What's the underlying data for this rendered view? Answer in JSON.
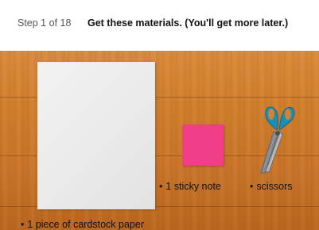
{
  "header": {
    "step": "Step 1 of 18",
    "title": "Get these materials. (You'll get more later.)"
  },
  "items": [
    {
      "bullet": "•",
      "label": "1 sticky note"
    },
    {
      "bullet": "•",
      "label": "scissors"
    },
    {
      "bullet": "•",
      "label": "1 piece of cardstock paper"
    }
  ],
  "colors": {
    "sticky_note": "#f03f86",
    "scissors_handle": "#1a8fb5",
    "table": "#d4822f"
  },
  "icons": [
    "scissors-illustration",
    "sticky-note-illustration",
    "cardstock-illustration"
  ]
}
